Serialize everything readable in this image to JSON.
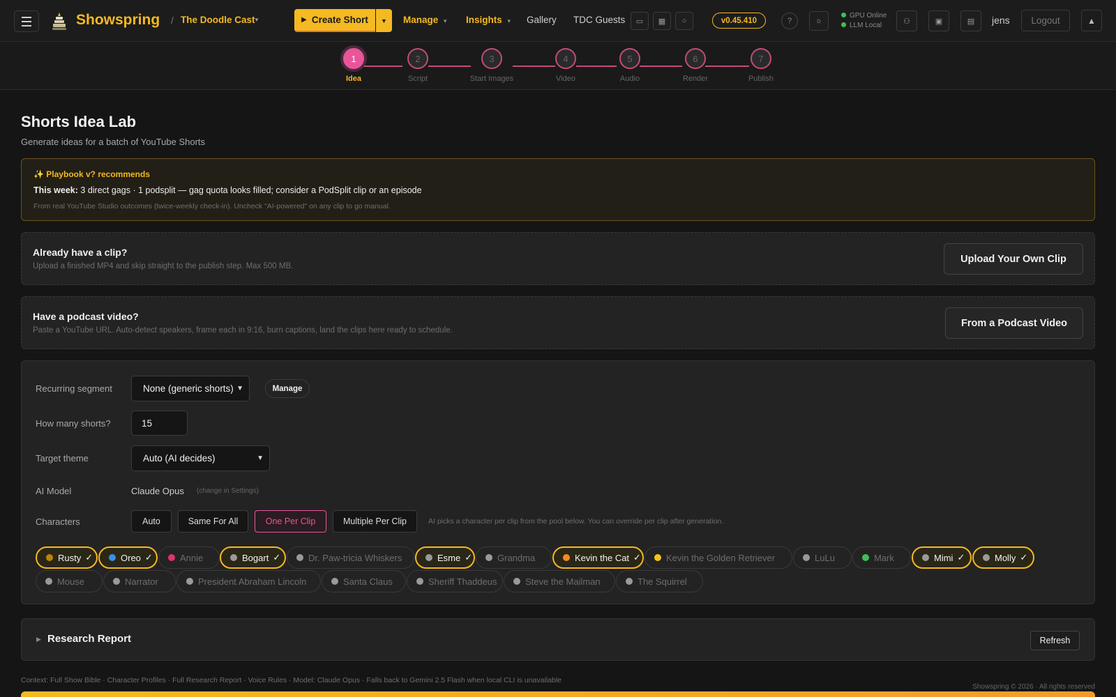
{
  "header": {
    "brand": "Showspring",
    "channel": "The Doodle Cast",
    "create_label": "Create Short",
    "nav": {
      "manage": "Manage",
      "insights": "Insights",
      "gallery": "Gallery",
      "guests": "TDC Guests"
    },
    "version": "v0.45.410",
    "status": {
      "gpu": "GPU Online",
      "llm": "LLM Local"
    },
    "user": "jens",
    "logout": "Logout"
  },
  "stepper": {
    "steps": [
      {
        "num": "1",
        "label": "Idea"
      },
      {
        "num": "2",
        "label": "Script"
      },
      {
        "num": "3",
        "label": "Start Images"
      },
      {
        "num": "4",
        "label": "Video"
      },
      {
        "num": "5",
        "label": "Audio"
      },
      {
        "num": "6",
        "label": "Render"
      },
      {
        "num": "7",
        "label": "Publish"
      }
    ],
    "active_step": 1
  },
  "page": {
    "title": "Shorts Idea Lab",
    "subtitle": "Generate ideas for a batch of YouTube Shorts"
  },
  "recommendation": {
    "title": "Playbook v? recommends",
    "week_label": "This week:",
    "week_text": " 3 direct gags · 1 podsplit — gag quota looks filled; consider a PodSplit clip or an episode",
    "footnote": "From real YouTube Studio outcomes (twice-weekly check-in). Uncheck \"AI-powered\" on any clip to go manual."
  },
  "upload_card": {
    "title": "Already have a clip?",
    "desc": "Upload a finished MP4 and skip straight to the publish step. Max 500 MB.",
    "button": "Upload Your Own Clip"
  },
  "podcast_card": {
    "title": "Have a podcast video?",
    "desc": "Paste a YouTube URL. Auto-detect speakers, frame each in 9:16, burn captions, land the clips here ready to schedule.",
    "button": "From a Podcast Video"
  },
  "form": {
    "segment_label": "Recurring segment",
    "segment_value": "None (generic shorts)",
    "manage_label": "Manage",
    "count_label": "How many shorts?",
    "count_value": "15",
    "theme_label": "Target theme",
    "theme_value": "Auto (AI decides)",
    "model_label": "AI Model",
    "model_value": "Claude Opus",
    "model_hint": "(change in Settings)",
    "characters_label": "Characters",
    "modes": [
      "Auto",
      "Same For All",
      "One Per Clip",
      "Multiple Per Clip"
    ],
    "active_mode": "One Per Clip",
    "mode_hint": "AI picks a character per clip from the pool below. You can override per clip after generation."
  },
  "characters": [
    {
      "name": "Rusty",
      "selected": true,
      "color": "#b8860b"
    },
    {
      "name": "Oreo",
      "selected": true,
      "color": "#3a8ee6"
    },
    {
      "name": "Annie",
      "selected": false,
      "color": "#e0336b"
    },
    {
      "name": "Bogart",
      "selected": true,
      "color": "#9a9a9a"
    },
    {
      "name": "Dr. Paw-tricia Whiskers",
      "selected": false,
      "color": "#9a9a9a"
    },
    {
      "name": "Esme",
      "selected": true,
      "color": "#9a9a9a"
    },
    {
      "name": "Grandma",
      "selected": false,
      "color": "#9a9a9a"
    },
    {
      "name": "Kevin the Cat",
      "selected": true,
      "color": "#f58a1f"
    },
    {
      "name": "Kevin the Golden Retriever",
      "selected": false,
      "color": "#f5c21f"
    },
    {
      "name": "LuLu",
      "selected": false,
      "color": "#9a9a9a"
    },
    {
      "name": "Mark",
      "selected": false,
      "color": "#3fbf5a"
    },
    {
      "name": "Mimi",
      "selected": true,
      "color": "#9a9a9a"
    },
    {
      "name": "Molly",
      "selected": true,
      "color": "#9a9a9a"
    },
    {
      "name": "Mouse",
      "selected": false,
      "color": "#9a9a9a"
    },
    {
      "name": "Narrator",
      "selected": false,
      "color": "#9a9a9a"
    },
    {
      "name": "President Abraham Lincoln",
      "selected": false,
      "color": "#9a9a9a"
    },
    {
      "name": "Santa Claus",
      "selected": false,
      "color": "#9a9a9a"
    },
    {
      "name": "Sheriff Thaddeus",
      "selected": false,
      "color": "#9a9a9a"
    },
    {
      "name": "Steve the Mailman",
      "selected": false,
      "color": "#9a9a9a"
    },
    {
      "name": "The Squirrel",
      "selected": false,
      "color": "#9a9a9a"
    }
  ],
  "research": {
    "title": "Research Report",
    "refresh": "Refresh"
  },
  "context_line": "Context: Full Show Bible · Character Profiles · Full Research Report · Voice Rules · Model: Claude Opus · Falls back to Gemini 2.5 Flash when local CLI is unavailable",
  "footer": "Showspring © 2026 · All rights reserved",
  "colors": {
    "accent": "#f5b921",
    "pink": "#e9559a",
    "bg": "#151515"
  }
}
